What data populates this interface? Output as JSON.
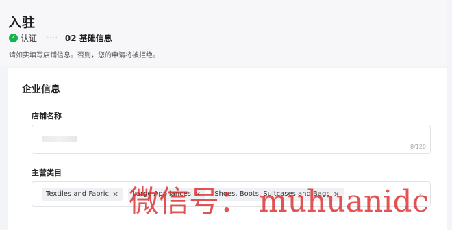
{
  "header": {
    "title": "入驻",
    "steps": [
      {
        "label": "认证",
        "status": "done"
      },
      {
        "label": "02 基础信息",
        "status": "current"
      }
    ],
    "step_separator": "·····",
    "subtitle": "请如实填写店铺信息。否则，您的申请将被拒绝。"
  },
  "card": {
    "title": "企业信息",
    "store_name": {
      "label": "店铺名称",
      "value": "",
      "char_count": "8/120"
    },
    "main_category": {
      "label": "主营类目",
      "tags": [
        {
          "label": "Textiles and Fabric",
          "remove": "×"
        },
        {
          "label": "Large Appliances",
          "remove": "×"
        },
        {
          "label": "Shoes, Boots, Suitcases and Bags",
          "remove": "×"
        }
      ],
      "dropdown_icon": "chevron-down"
    }
  },
  "watermark": "微信号： muhuanidc",
  "colors": {
    "success": "#16b34a",
    "watermark": "#dc2828"
  }
}
